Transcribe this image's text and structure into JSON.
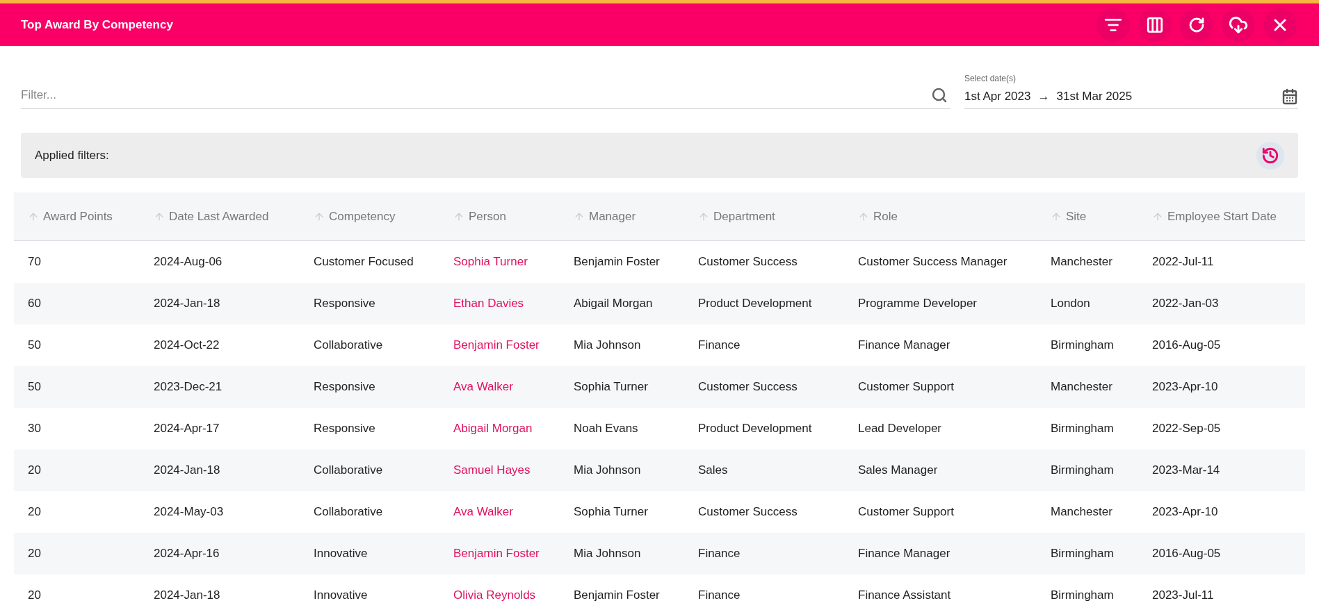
{
  "header": {
    "title": "Top Award By Competency"
  },
  "filter": {
    "placeholder": "Filter..."
  },
  "date_range": {
    "label": "Select date(s)",
    "start": "1st Apr 2023",
    "arrow": "→",
    "end": "31st Mar 2025"
  },
  "applied_filters": {
    "label": "Applied filters:"
  },
  "table": {
    "columns": [
      "Award Points",
      "Date Last Awarded",
      "Competency",
      "Person",
      "Manager",
      "Department",
      "Role",
      "Site",
      "Employee Start Date"
    ],
    "rows": [
      [
        "70",
        "2024-Aug-06",
        "Customer Focused",
        "Sophia Turner",
        "Benjamin Foster",
        "Customer Success",
        "Customer Success Manager",
        "Manchester",
        "2022-Jul-11"
      ],
      [
        "60",
        "2024-Jan-18",
        "Responsive",
        "Ethan Davies",
        "Abigail Morgan",
        "Product Development",
        "Programme Developer",
        "London",
        "2022-Jan-03"
      ],
      [
        "50",
        "2024-Oct-22",
        "Collaborative",
        "Benjamin Foster",
        "Mia Johnson",
        "Finance",
        "Finance Manager",
        "Birmingham",
        "2016-Aug-05"
      ],
      [
        "50",
        "2023-Dec-21",
        "Responsive",
        "Ava Walker",
        "Sophia Turner",
        "Customer Success",
        "Customer Support",
        "Manchester",
        "2023-Apr-10"
      ],
      [
        "30",
        "2024-Apr-17",
        "Responsive",
        "Abigail Morgan",
        "Noah Evans",
        "Product Development",
        "Lead Developer",
        "Birmingham",
        "2022-Sep-05"
      ],
      [
        "20",
        "2024-Jan-18",
        "Collaborative",
        "Samuel Hayes",
        "Mia Johnson",
        "Sales",
        "Sales Manager",
        "Birmingham",
        "2023-Mar-14"
      ],
      [
        "20",
        "2024-May-03",
        "Collaborative",
        "Ava Walker",
        "Sophia Turner",
        "Customer Success",
        "Customer Support",
        "Manchester",
        "2023-Apr-10"
      ],
      [
        "20",
        "2024-Apr-16",
        "Innovative",
        "Benjamin Foster",
        "Mia Johnson",
        "Finance",
        "Finance Manager",
        "Birmingham",
        "2016-Aug-05"
      ],
      [
        "20",
        "2024-Jan-18",
        "Innovative",
        "Olivia Reynolds",
        "Benjamin Foster",
        "Finance",
        "Finance Assistant",
        "Birmingham",
        "2023-Jul-11"
      ]
    ]
  }
}
